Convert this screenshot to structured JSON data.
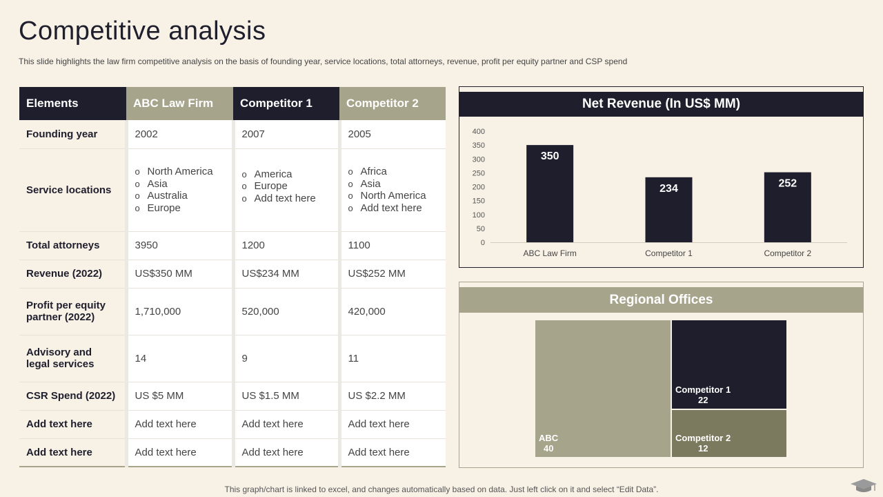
{
  "slide": {
    "title": "Competitive analysis",
    "subtitle": "This slide highlights the law firm competitive analysis on the basis of founding year, service locations, total attorneys, revenue, profit per equity partner and CSP spend",
    "footer": "This graph/chart is linked to excel,  and changes automatically based on data. Just left click on it and select “Edit Data”."
  },
  "table": {
    "headers": [
      "Elements",
      "ABC Law Firm",
      "Competitor 1",
      "Competitor 2"
    ],
    "rows": [
      {
        "label": "Founding year",
        "cells": [
          "2002",
          "2007",
          "2005"
        ]
      },
      {
        "label": "Service locations",
        "lists": [
          [
            "North America",
            "Asia",
            "Australia",
            "Europe"
          ],
          [
            "America",
            "Europe",
            "Add text here"
          ],
          [
            "Africa",
            "Asia",
            "North America",
            "Add text here"
          ]
        ]
      },
      {
        "label": "Total attorneys",
        "cells": [
          "3950",
          "1200",
          "1100"
        ]
      },
      {
        "label": "Revenue (2022)",
        "cells": [
          "US$350 MM",
          "US$234 MM",
          "US$252 MM"
        ]
      },
      {
        "label": "Profit per equity partner (2022)",
        "cells": [
          "1,710,000",
          "520,000",
          "420,000"
        ]
      },
      {
        "label": "Advisory and legal services",
        "cells": [
          "14",
          "9",
          "11"
        ]
      },
      {
        "label": "CSR Spend (2022)",
        "cells": [
          "US $5 MM",
          "US $1.5 MM",
          "US $2.2 MM"
        ]
      },
      {
        "label": "Add text here",
        "cells": [
          "Add text here",
          "Add text here",
          "Add text here"
        ]
      },
      {
        "label": "Add text here",
        "cells": [
          "Add text here",
          "Add text here",
          "Add text here"
        ]
      }
    ]
  },
  "chart_data": [
    {
      "type": "bar",
      "title": "Net Revenue (In US$ MM)",
      "categories": [
        "ABC Law Firm",
        "Competitor 1",
        "Competitor 2"
      ],
      "values": [
        350,
        234,
        252
      ],
      "ylim": [
        0,
        400
      ],
      "yticks": [
        0,
        50,
        100,
        150,
        200,
        250,
        300,
        350,
        400
      ],
      "grid": false,
      "bar_color": "#1e1e2c"
    },
    {
      "type": "treemap",
      "title": "Regional Offices",
      "items": [
        {
          "label": "ABC",
          "value": 40,
          "color": "#a7a48c"
        },
        {
          "label": "Competitor 1",
          "value": 22,
          "color": "#1e1e2c"
        },
        {
          "label": "Competitor 2",
          "value": 12,
          "color": "#7b7a5e"
        }
      ]
    }
  ],
  "colors": {
    "dark": "#1e1e2c",
    "tan": "#a7a48c",
    "olive": "#7b7a5e",
    "background": "#f7f1e6"
  },
  "icons": {
    "corner": "graduation-cap-icon"
  }
}
